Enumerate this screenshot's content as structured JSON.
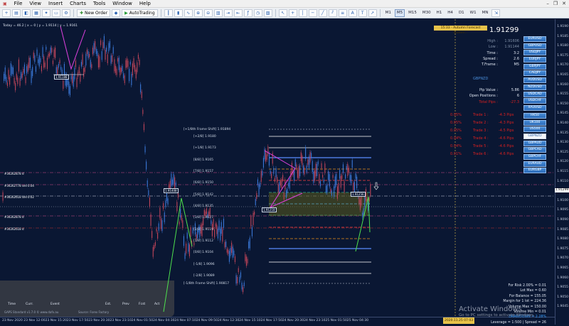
{
  "menu": [
    "File",
    "View",
    "Insert",
    "Charts",
    "Tools",
    "Window",
    "Help"
  ],
  "toolbar": {
    "new_order": "New Order",
    "autotrading": "AutoTrading",
    "timeframes": [
      "M1",
      "M5",
      "M15",
      "M30",
      "H1",
      "H4",
      "D1",
      "W1",
      "MN"
    ],
    "active_tf": "M5"
  },
  "chart": {
    "info_line": "Today = 46.2  |  x = 0  |  y = 1.9114  |  y = 1.9161",
    "levels": [
      {
        "label": "[+1/8th Frame Shift] 1.91894",
        "color": "#8c92a6"
      },
      {
        "label": "[+2/8] 1.9180",
        "color": "#ffffff"
      },
      {
        "label": "[+1/8] 1.9173",
        "color": "#ffffff"
      },
      {
        "label": "[8/8] 1.9165",
        "color": "#5b8cff"
      },
      {
        "label": "[7/8] 1.9157",
        "color": "#e88d1a"
      },
      {
        "label": "[6/8] 1.9150",
        "color": "#ff4040"
      },
      {
        "label": "[5/8] 1.9142",
        "color": "#26c6b5"
      },
      {
        "label": "[4/8] 1.9135",
        "color": "#3aa0ff"
      },
      {
        "label": "[3/8] 1.9127",
        "color": "#26c6b5"
      },
      {
        "label": "[2/8] 1.9119",
        "color": "#ff4040"
      },
      {
        "label": "[1/8] 1.9112",
        "color": "#e88d1a"
      },
      {
        "label": "[0/8] 1.9104",
        "color": "#5b8cff"
      },
      {
        "label": "[-1/8] 1.9096",
        "color": "#ffffff"
      },
      {
        "label": "[-2/8] 1.9089",
        "color": "#ffffff"
      },
      {
        "label": "[-1/8th Frame Shift] 1.90817",
        "color": "#8c92a6"
      }
    ],
    "left_tags": [
      "#34262878 d",
      "#34262778 sell 0.04",
      "#34262618 sell 0.02",
      "#34262878 d",
      "#34262618 d"
    ],
    "box_tags": [
      "1.91408",
      "1.91256",
      "1.91218",
      "1.91188"
    ],
    "events": [
      "Time",
      "Curr.",
      "Event",
      "Est.",
      "Prev",
      "Fcst",
      "Act"
    ],
    "footer_left": "GAPS Standard v1.7.0 © www.dafx.au",
    "footer_mid": "Source: Forex Factory"
  },
  "price_axis": [
    "1.9190",
    "1.9185",
    "1.9180",
    "1.9175",
    "1.9170",
    "1.9165",
    "1.9160",
    "1.9155",
    "1.9150",
    "1.9145",
    "1.9140",
    "1.9135",
    "1.9130",
    "1.9125",
    "1.9120",
    "1.9115",
    "1.9110",
    "1.9105",
    "1.9100",
    "1.9095",
    "1.9090",
    "1.9085",
    "1.9080",
    "1.9075",
    "1.9070",
    "1.9065",
    "1.9060",
    "1.9055",
    "1.9050",
    "1.9045"
  ],
  "current_price_tag": "1.91299",
  "time_axis": [
    "23 Nov 2020",
    "23 Nov 12:00",
    "23 Nov 15:20",
    "23 Nov 17:50",
    "23 Nov 20:30",
    "23 Nov 23:10",
    "24 Nov 01:50",
    "24 Nov 04:30",
    "24 Nov 07:10",
    "24 Nov 09:50",
    "24 Nov 12:30",
    "24 Nov 15:10",
    "24 Nov 17:50",
    "24 Nov 20:30",
    "24 Nov 23:10",
    "25 Nov 01:50",
    "25 Nov 04:30"
  ],
  "time_axis_tag": "2020.11.25 07:03",
  "panel": {
    "banner": "15:33 - Autumn Forecast Statem...",
    "big_price": "1.91299",
    "stats": [
      {
        "k": "High :",
        "v": "1.91606",
        "dim": true
      },
      {
        "k": "Low :",
        "v": "1.91144",
        "dim": true
      },
      {
        "k": "Time :",
        "v": "3:2",
        "dim": false
      },
      {
        "k": "Spread :",
        "v": "2.6",
        "dim": false
      },
      {
        "k": "T.Frame :",
        "v": "M5",
        "dim": false
      }
    ],
    "symbol": "GBPNZD",
    "stats2": [
      {
        "k": "Pip Value :",
        "v": "5.86"
      },
      {
        "k": "Open Positions :",
        "v": "6"
      },
      {
        "k": "Total Pips :",
        "v": "-27.3"
      }
    ],
    "trades": [
      {
        "pct": "0.05%",
        "name": "Trade 1 :",
        "pips": "-4.3 Pips"
      },
      {
        "pct": "0.05%",
        "name": "Trade 2 :",
        "pips": "-4.3 Pips"
      },
      {
        "pct": "0.05%",
        "name": "Trade 3 :",
        "pips": "-4.5 Pips"
      },
      {
        "pct": "0.04%",
        "name": "Trade 4 :",
        "pips": "-4.6 Pips"
      },
      {
        "pct": "0.04%",
        "name": "Trade 5 :",
        "pips": "-4.6 Pips"
      },
      {
        "pct": "0.01%",
        "name": "Trade 6 :",
        "pips": "-4.6 Pips"
      }
    ],
    "symbols": [
      "EURUSD",
      "GBPUSD",
      "USDJPY",
      "EURJPY",
      "GBPJPY",
      "CADJPY",
      "AUDUSD",
      "NZDUSD",
      "USDCAD",
      "USDCHF",
      "XAUUSD",
      "HK50",
      "UK100",
      "US500",
      "GBPNZD",
      "GBPAUD",
      "GBPCAD",
      "GBPCHF",
      "EURAUD",
      "EURGBP"
    ],
    "selected_symbol": "GBPNZD",
    "gap_after": [
      "USDCHF",
      "XAUUSD"
    ]
  },
  "calc": [
    {
      "t": "For Risk 2.00% = 0.01",
      "hl": false
    },
    {
      "t": "Lot Max = 0.60",
      "hl": false
    },
    {
      "t": "For Balance = 155.05",
      "hl": false
    },
    {
      "t": "Margin for 1 lot = 224.36",
      "hl": false
    },
    {
      "t": "Volume Max = 150.00",
      "hl": false
    },
    {
      "t": "Volume Min = 0.01",
      "hl": false
    },
    {
      "t": "DRAWDOWN = 2.28%",
      "hl": true
    },
    {
      "t": "Leverage = 1:500 | Spread = 26",
      "hl": false
    }
  ],
  "activate": {
    "title": "Activate Windows",
    "sub": "Go to PC settings to activate Windows."
  }
}
